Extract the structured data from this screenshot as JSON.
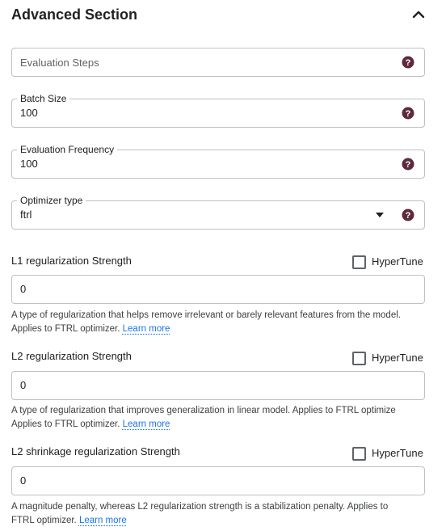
{
  "section": {
    "title": "Advanced Section"
  },
  "fields": {
    "evaluation_steps": {
      "placeholder": "Evaluation Steps"
    },
    "batch_size": {
      "label": "Batch Size",
      "value": "100"
    },
    "evaluation_frequency": {
      "label": "Evaluation Frequency",
      "value": "100"
    },
    "optimizer_type": {
      "label": "Optimizer type",
      "value": "ftrl"
    }
  },
  "regularization": [
    {
      "label": "L1 regularization Strength",
      "hypertune": "HyperTune",
      "value": "0",
      "desc_line1": "A type of regularization that helps remove irrelevant or barely relevant features from the model.",
      "desc_line2": "Applies to FTRL optimizer.",
      "link": "Learn more"
    },
    {
      "label": "L2 regularization Strength",
      "hypertune": "HyperTune",
      "value": "0",
      "desc_line1": "A type of regularization that improves generalization in linear model. Applies to FTRL optimize",
      "desc_line2": "Applies to FTRL optimizer.",
      "link": "Learn more"
    },
    {
      "label": "L2 shrinkage regularization Strength",
      "hypertune": "HyperTune",
      "value": "0",
      "desc_line1": "A magnitude penalty, whereas L2 regularization strength is a stabilization penalty. Applies to",
      "desc_line2": "FTRL optimizer.",
      "link": "Learn more"
    }
  ],
  "colors": {
    "help_icon": "#5e2a3b",
    "link": "#1a73e8",
    "border": "#bdc1c6"
  }
}
